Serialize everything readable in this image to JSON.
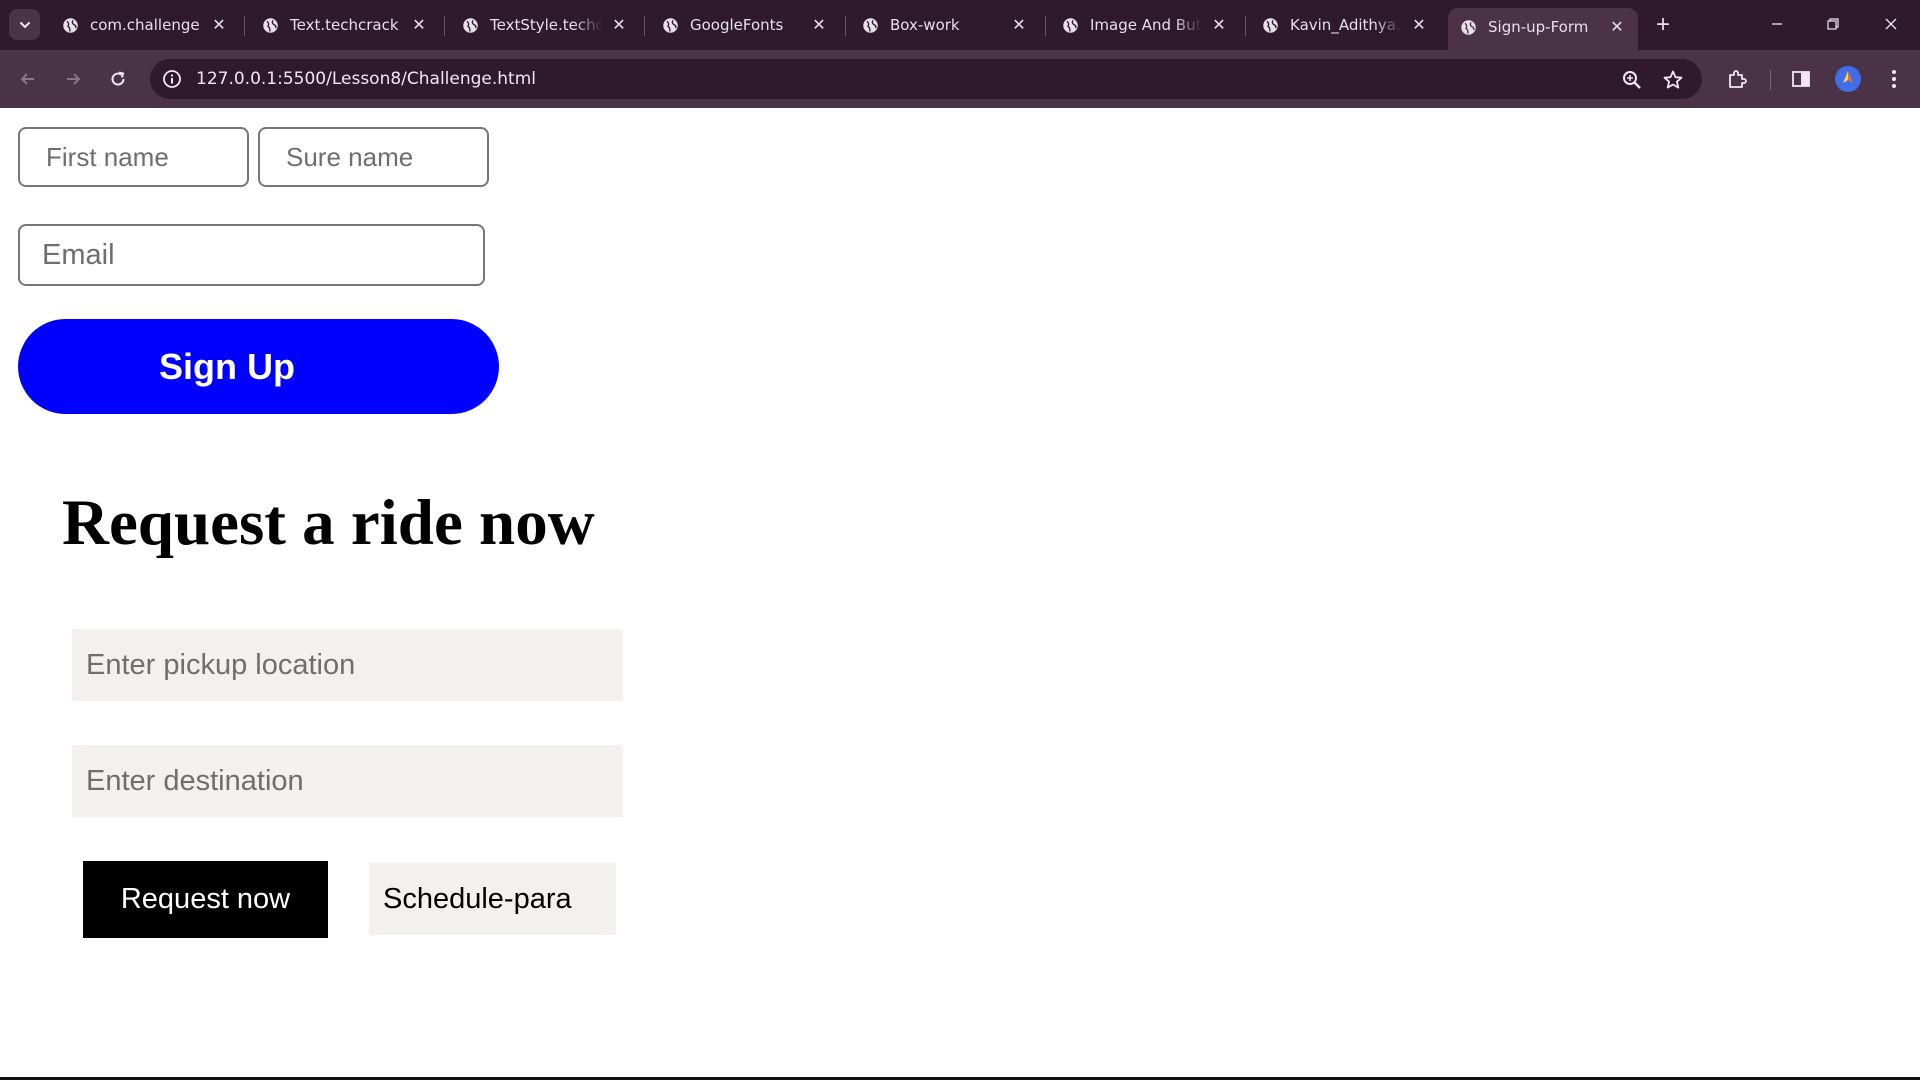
{
  "browser": {
    "tabs": [
      {
        "label": "com.challenge",
        "active": false
      },
      {
        "label": "Text.techcrack",
        "active": false
      },
      {
        "label": "TextStyle.techcrack",
        "active": false
      },
      {
        "label": "GoogleFonts",
        "active": false
      },
      {
        "label": "Box-work",
        "active": false
      },
      {
        "label": "Image And Buttons",
        "active": false
      },
      {
        "label": "Kavin_Adithya.dk",
        "active": false
      },
      {
        "label": "Sign-up-Form",
        "active": true
      }
    ],
    "url": "127.0.0.1:5500/Lesson8/Challenge.html",
    "colors": {
      "tabbar": "#2e1a2c",
      "toolbar": "#4a3347"
    }
  },
  "signup": {
    "first_name_placeholder": "First name",
    "surname_placeholder": "Sure name",
    "email_placeholder": "Email",
    "button_label": "Sign Up",
    "button_color": "#0000ff"
  },
  "ride": {
    "title": "Request a ride now",
    "pickup_placeholder": "Enter pickup location",
    "destination_placeholder": "Enter destination",
    "request_label": "Request now",
    "schedule_label": "Schedule-para"
  }
}
